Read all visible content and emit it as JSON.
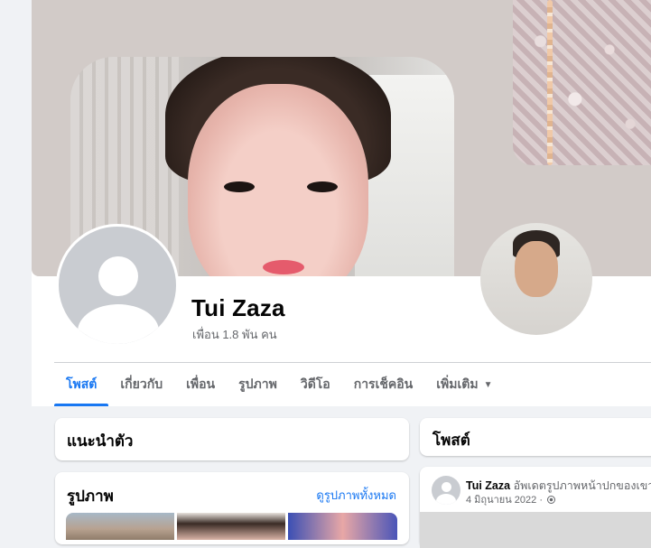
{
  "profile": {
    "name": "Tui Zaza",
    "friends": "เพื่อน 1.8 พัน คน"
  },
  "tabs": [
    {
      "label": "โพสต์",
      "active": true
    },
    {
      "label": "เกี่ยวกับ"
    },
    {
      "label": "เพื่อน"
    },
    {
      "label": "รูปภาพ"
    },
    {
      "label": "วิดีโอ"
    },
    {
      "label": "การเช็คอิน"
    },
    {
      "label": "เพิ่มเติม",
      "icon": "caret-down-icon"
    }
  ],
  "intro": {
    "title": "แนะนำตัว"
  },
  "photos": {
    "title": "รูปภาพ",
    "see_all": "ดูรูปภาพทั้งหมด"
  },
  "posts": {
    "title": "โพสต์",
    "first": {
      "author": "Tui Zaza",
      "action": "อัพเดตรูปภาพหน้าปกของเขา",
      "date": "4 มิถุนายน 2022 ·",
      "privacy_icon": "globe-icon"
    }
  },
  "colors": {
    "accent": "#1877f2",
    "page_bg": "#f0f2f5",
    "text_secondary": "#65676b",
    "cover_bg": "#d2cbc8"
  }
}
